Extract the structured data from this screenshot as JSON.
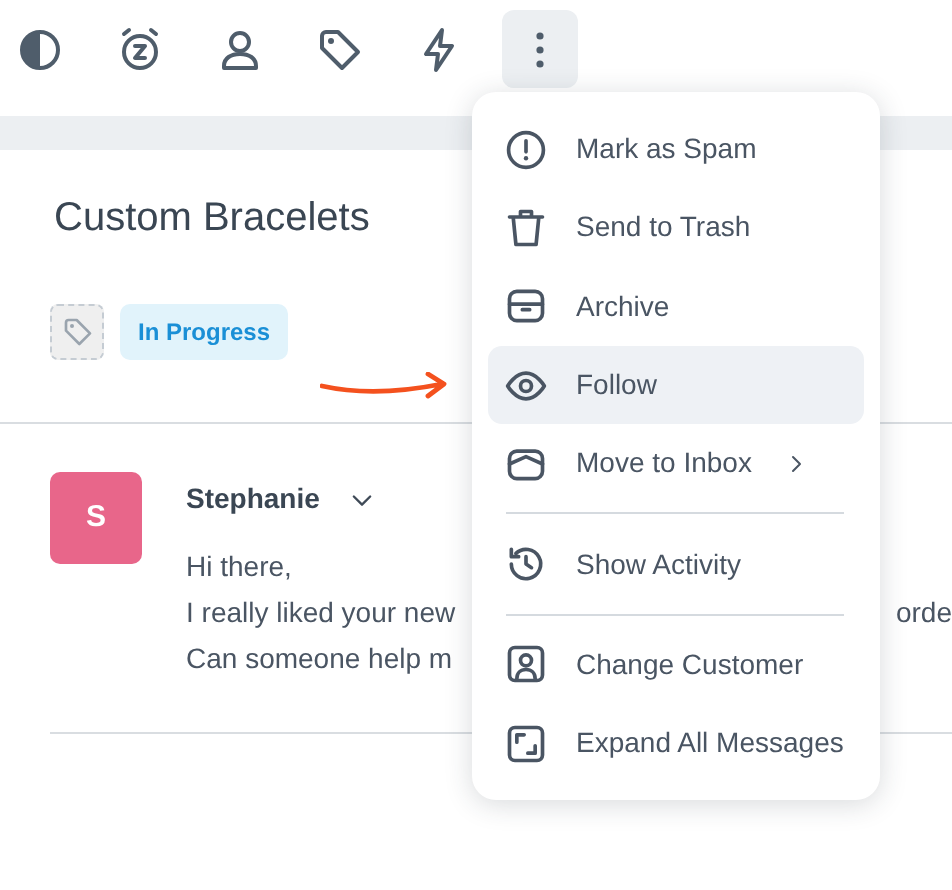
{
  "toolbar": [
    {
      "kind": "contrast",
      "active": false
    },
    {
      "kind": "snooze",
      "active": false
    },
    {
      "kind": "user",
      "active": false
    },
    {
      "kind": "tag",
      "active": false
    },
    {
      "kind": "bolt",
      "active": false
    },
    {
      "kind": "more",
      "active": true
    }
  ],
  "conversation": {
    "title": "Custom Bracelets",
    "status": "In Progress"
  },
  "message": {
    "avatar_initial": "S",
    "sender": "Stephanie",
    "body_lines": [
      [
        "Hi there,"
      ],
      [
        "I really liked your new",
        "orde"
      ],
      [
        "Can someone help m"
      ]
    ]
  },
  "menu": [
    {
      "kind": "item",
      "label": "Mark as Spam",
      "selected": false
    },
    {
      "kind": "item",
      "label": "Send to Trash",
      "selected": false
    },
    {
      "kind": "item",
      "label": "Archive",
      "selected": false
    },
    {
      "kind": "item",
      "label": "Follow",
      "selected": true
    },
    {
      "kind": "item",
      "label": "Move to Inbox",
      "selected": false,
      "submenu": true
    },
    {
      "kind": "divider"
    },
    {
      "kind": "item",
      "label": "Show Activity",
      "selected": false
    },
    {
      "kind": "divider"
    },
    {
      "kind": "item",
      "label": "Change Customer",
      "selected": false
    },
    {
      "kind": "item",
      "label": "Expand All Messages",
      "selected": false
    }
  ]
}
